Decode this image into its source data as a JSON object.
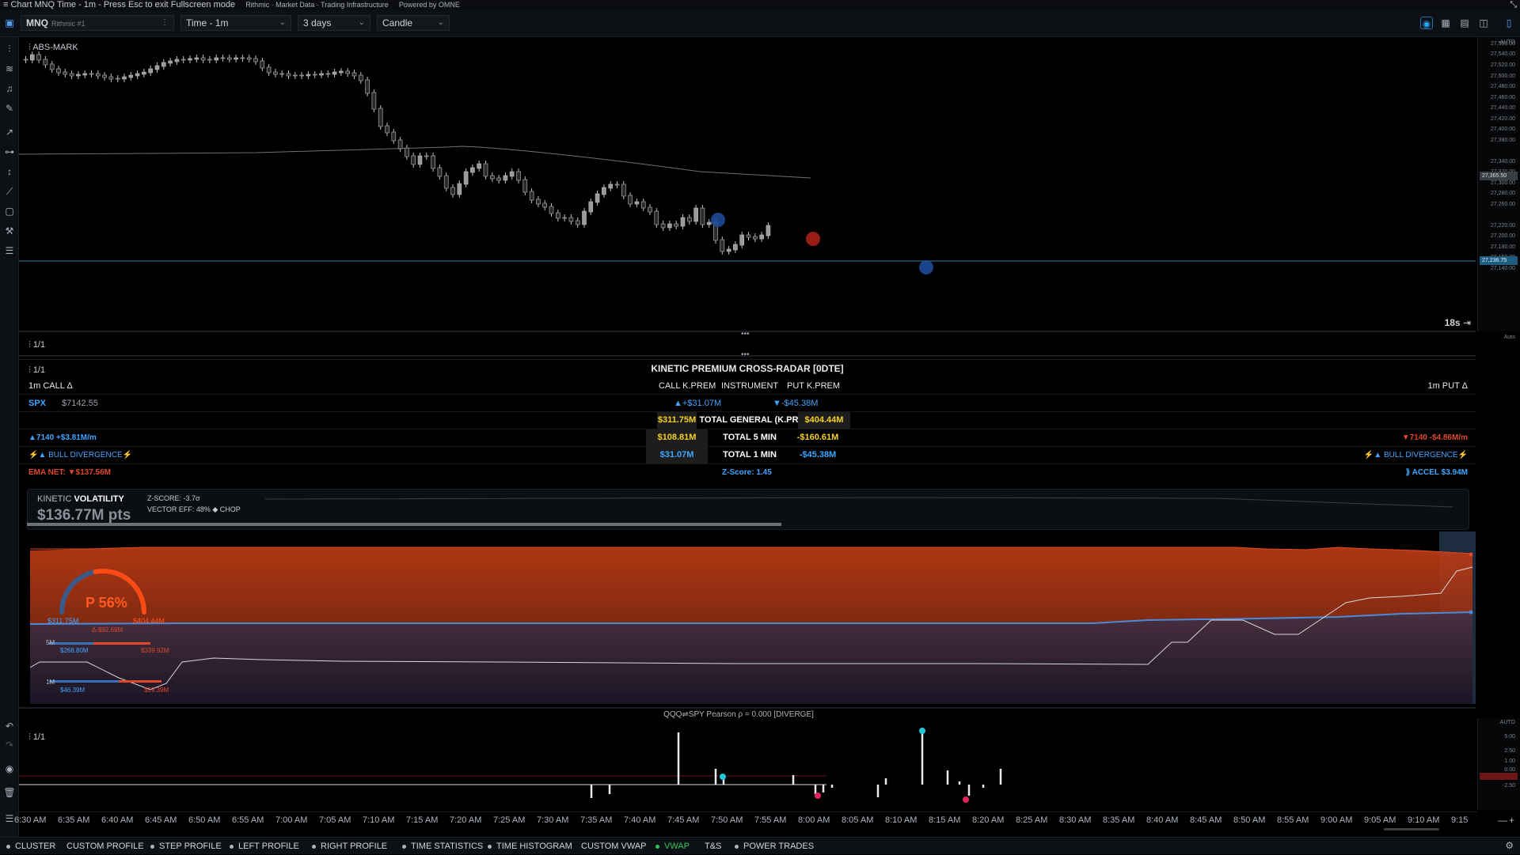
{
  "window": {
    "title": "Chart MNQ Time - 1m - Press Esc to exit Fullscreen mode",
    "provider": "Rithmic · Market Data · Trading Infrastructure",
    "powered_by": "Powered by OMNE"
  },
  "toolbar": {
    "symbol": "MNQ",
    "connection": "Rithmic #1",
    "timeframe": "Time - 1m",
    "range": "3 days",
    "chart_type": "Candle"
  },
  "main_chart": {
    "indicator_label": "ABS-MARK",
    "countdown": "18s",
    "price_axis": {
      "mode_top": "AUTO",
      "mode_bottom": "Auto",
      "ticks": [
        "27,560.00",
        "27,540.00",
        "27,520.00",
        "27,500.00",
        "27,480.00",
        "27,460.00",
        "27,440.00",
        "27,420.00",
        "27,400.00",
        "27,380.00",
        "27,340.00",
        "27,320.00",
        "27,300.00",
        "27,280.00",
        "27,260.00",
        "27,220.00",
        "27,200.00",
        "27,180.00",
        "27,160.00",
        "27,140.00"
      ],
      "flag_vwap": "27,365.50",
      "flag_last": "27,236.75"
    }
  },
  "pane_tags": {
    "pane2": "1/1",
    "pane3": "1/1",
    "pane4": "1/1"
  },
  "radar": {
    "title": "KINETIC PREMIUM CROSS-RADAR  [0DTE]",
    "left_header": "1m CALL Δ",
    "right_header": "1m PUT Δ",
    "col_call": "CALL K.PREM",
    "col_instrument": "INSTRUMENT",
    "col_put": "PUT K.PREM",
    "instrument": "SPX",
    "instrument_price": "$7142.55",
    "call_prem": "▲+$31.07M",
    "put_prem": "▼-$45.38M",
    "total_general": {
      "label": "TOTAL GENERAL (K.PREM)",
      "call": "$311.75M",
      "put": "$404.44M"
    },
    "total_5": {
      "label": "TOTAL 5 MIN",
      "call": "$108.81M",
      "put": "-$160.61M"
    },
    "total_1": {
      "label": "TOTAL 1 MIN",
      "call": "$31.07M",
      "put": "-$45.38M"
    },
    "left_strike": "▲7140 +$3.81M/m",
    "right_strike": "▼7140 -$4.86M/m",
    "left_divergence": "⚡▲ BULL DIVERGENCE⚡",
    "right_divergence": "⚡▲ BULL DIVERGENCE⚡",
    "ema_net": "EMA NET: ▼$137.56M",
    "zscore": "Z-Score: 1.45",
    "accel": "⟫ ACCEL $3.94M"
  },
  "volatility": {
    "label_a": "KINETIC",
    "label_b": "VOLATILITY",
    "zscore": "Z-SCORE: -3.7σ",
    "vector": "VECTOR EFF: 48% ◆ CHOP",
    "value": "$136.77M pts"
  },
  "gauge": {
    "label": "P 56%",
    "left_value": "$311.75M",
    "right_value": "$404.44M",
    "delta": "Δ-$92.69M",
    "row5_label": "5M",
    "row5_left": "$268.80M",
    "row5_right": "$339.92M",
    "row1_label": "1M",
    "row1_left": "$46.39M",
    "row1_right": "$29.39M",
    "put_share": 0.56
  },
  "sub_panel": {
    "title": "QQQ⇌SPY Pearson ρ = 0.000 [DIVERGE]",
    "axis_ticks": [
      "AUTO",
      "5.00",
      "2.50",
      "1.00",
      "0.00",
      "-2.50"
    ]
  },
  "x_axis": [
    "6:30 AM",
    "6:35 AM",
    "6:40 AM",
    "6:45 AM",
    "6:50 AM",
    "6:55 AM",
    "7:00 AM",
    "7:05 AM",
    "7:10 AM",
    "7:15 AM",
    "7:20 AM",
    "7:25 AM",
    "7:30 AM",
    "7:35 AM",
    "7:40 AM",
    "7:45 AM",
    "7:50 AM",
    "7:55 AM",
    "8:00 AM",
    "8:05 AM",
    "8:10 AM",
    "8:15 AM",
    "8:20 AM",
    "8:25 AM",
    "8:30 AM",
    "8:35 AM",
    "8:40 AM",
    "8:45 AM",
    "8:50 AM",
    "8:55 AM",
    "9:00 AM",
    "9:05 AM",
    "9:10 AM",
    "9:15"
  ],
  "bottom_tabs": [
    {
      "label": "CLUSTER",
      "dot": true
    },
    {
      "label": "CUSTOM PROFILE",
      "dot": false
    },
    {
      "label": "STEP PROFILE",
      "dot": true
    },
    {
      "label": "LEFT PROFILE",
      "dot": true
    },
    {
      "label": "RIGHT PROFILE",
      "dot": true
    },
    {
      "label": "TIME STATISTICS",
      "dot": true
    },
    {
      "label": "TIME HISTOGRAM",
      "dot": true
    },
    {
      "label": "CUSTOM VWAP",
      "dot": false
    },
    {
      "label": "VWAP",
      "dot": true,
      "active": true
    },
    {
      "label": "T&S",
      "dot": false
    },
    {
      "label": "POWER TRADES",
      "dot": true
    }
  ],
  "colors": {
    "bull": "#3b82f6",
    "bear": "#e0482a",
    "yellow": "#f5d020",
    "cyan": "#21c7d6",
    "magenta": "#e0245e"
  }
}
